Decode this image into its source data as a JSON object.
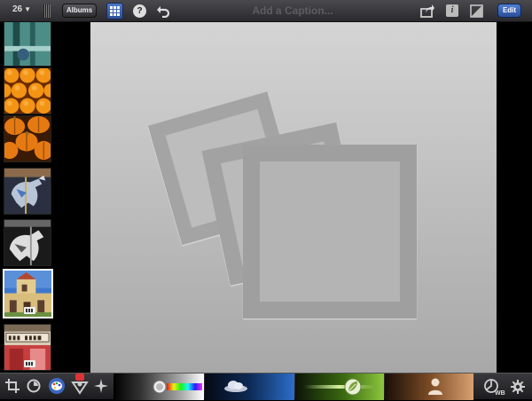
{
  "toolbar": {
    "photo_count": "26",
    "albums_label": "Albums",
    "caption_placeholder": "Add a Caption...",
    "edit_label": "Edit"
  },
  "filmstrip": {
    "thumbnails": [
      {
        "subject": "teal metal sculpture",
        "colors": [
          "#2e6f6a",
          "#86b9b3"
        ]
      },
      {
        "subject": "oranges",
        "colors": [
          "#f08c10",
          "#8a3c00"
        ]
      },
      {
        "subject": "pumpkins",
        "colors": [
          "#e0700c",
          "#5a2a05"
        ]
      },
      {
        "subject": "carousel horse",
        "colors": [
          "#3e4e70",
          "#a8a8b8"
        ]
      },
      {
        "subject": "carousel horse black and white",
        "colors": [
          "#222222",
          "#d8d8d8"
        ]
      },
      {
        "subject": "mission building",
        "colors": [
          "#e2c98a",
          "#3f77c9"
        ],
        "selected": true
      },
      {
        "subject": "bar room sign",
        "colors": [
          "#e8dfce",
          "#c43c3c"
        ]
      }
    ]
  },
  "bottom_tools": {
    "icons": [
      "crop-icon",
      "straighten-icon",
      "color-palette-icon",
      "brush-icon",
      "effects-icon"
    ],
    "sliders": [
      "exposure-slider",
      "sky-slider",
      "foliage-slider",
      "skin-tone-slider"
    ],
    "right_icons": [
      "white-balance-icon",
      "settings-gear-icon"
    ],
    "wb_label": "WB"
  },
  "colors": {
    "accent": "#3d68c0",
    "canvas_top": "#d4d4d4",
    "canvas_bottom": "#a8a8a8"
  }
}
